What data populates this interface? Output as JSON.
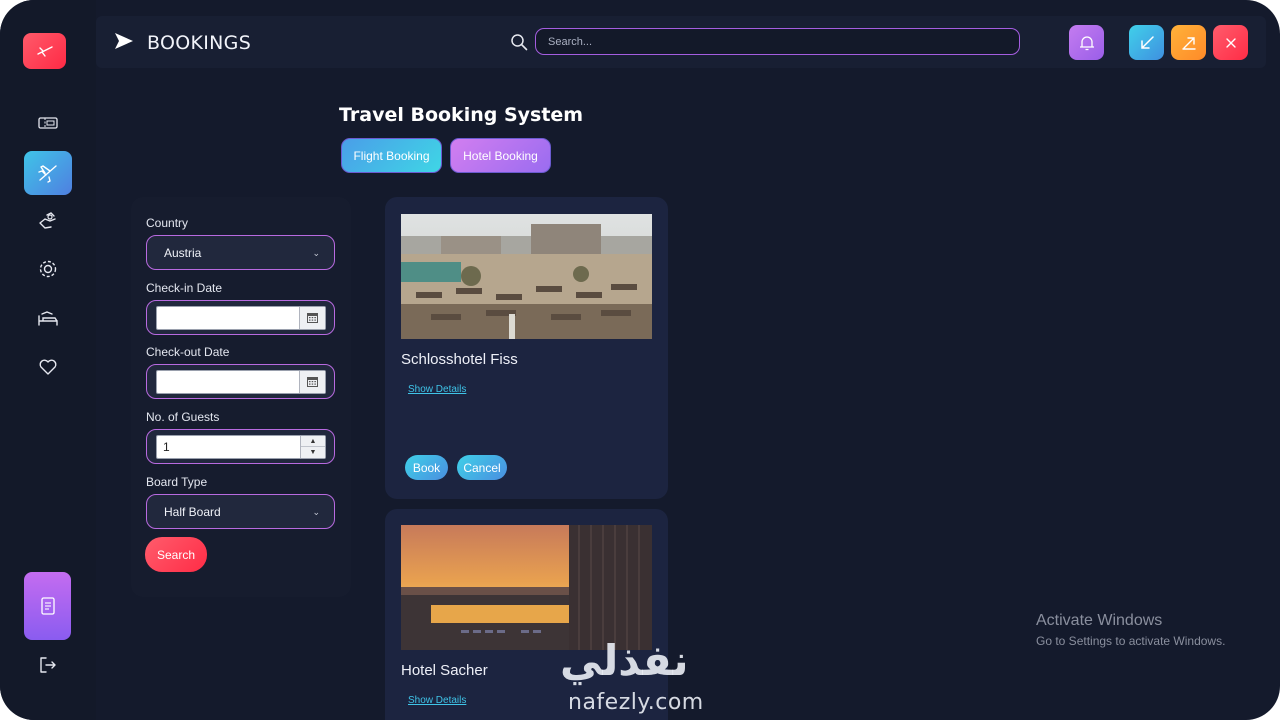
{
  "header": {
    "title": "BOOKINGS"
  },
  "search": {
    "placeholder": "Search..."
  },
  "main": {
    "heading": "Travel Booking System",
    "tabs": [
      {
        "label": "Flight Booking"
      },
      {
        "label": "Hotel Booking"
      }
    ]
  },
  "filters": {
    "country_label": "Country",
    "country_value": "Austria",
    "checkin_label": "Check-in Date",
    "checkout_label": "Check-out Date",
    "guests_label": "No. of Guests",
    "guests_value": "1",
    "board_label": "Board Type",
    "board_value": "Half Board",
    "search_label": "Search"
  },
  "hotels": [
    {
      "name": "Schlosshotel Fiss",
      "details_label": "Show Details",
      "book_label": "Book",
      "cancel_label": "Cancel"
    },
    {
      "name": "Hotel Sacher",
      "details_label": "Show Details"
    }
  ],
  "watermark": {
    "activate_title": "Activate Windows",
    "activate_sub": "Go to Settings to activate Windows.",
    "brand_ar": "نفذلي",
    "brand_en": "nafezly.com"
  },
  "colors": {
    "background": "#141a2c",
    "accent_cyan": "#3fc4e8",
    "accent_purple": "#b86ae0",
    "accent_red": "#ff3c54"
  },
  "icons": {
    "logo": "airplane-logo-icon",
    "sidebar": [
      "ticket-icon",
      "plane-icon",
      "hand-icon",
      "gear-icon",
      "bed-icon",
      "heart-icon",
      "document-icon",
      "logout-icon"
    ],
    "topbar": [
      "bell-icon",
      "minimize-icon",
      "maximize-icon",
      "close-icon"
    ]
  }
}
